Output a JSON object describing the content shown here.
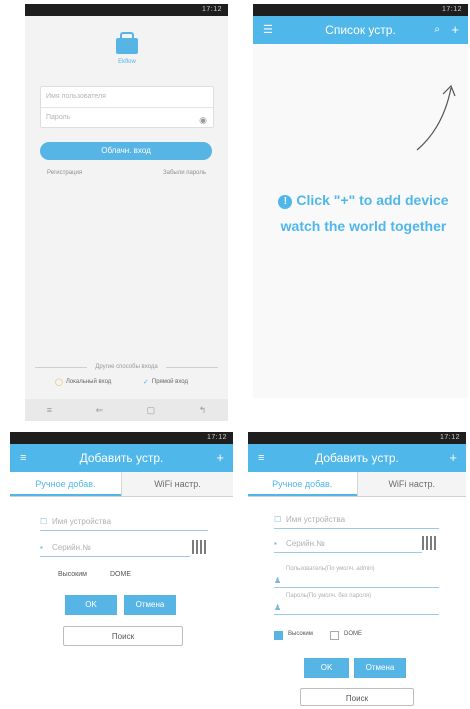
{
  "login": {
    "logo_text": "Ekflow",
    "username_placeholder": "Имя пользователя",
    "password_placeholder": "Пароль",
    "login_button": "Облачн. вход",
    "register_link": "Регистрация",
    "forgot_link": "Забыли пароль",
    "other_methods": "Другие способы входа",
    "local_login": "Локальный вход",
    "direct_login": "Прямой вход"
  },
  "device_list": {
    "title": "Список устр.",
    "hint_line1": "Click \"+\" to add device",
    "hint_line2": "watch the world together"
  },
  "add_device": {
    "title": "Добавить устр.",
    "tab_manual": "Ручное добав.",
    "tab_wifi": "WiFi настр.",
    "device_name": "Имя устройства",
    "serial": "Серийн.№",
    "username_field": "Пользователь(По умолч. admin)",
    "password_field": "Пароль(По умолч. без пароля)",
    "advanced": "Высоким",
    "dome": "DOME",
    "ok": "OK",
    "cancel": "Отмена",
    "search": "Поиск"
  },
  "status_time": "17:12",
  "colors": {
    "accent": "#4fb7ea",
    "accent_dark": "#56b5e5"
  }
}
